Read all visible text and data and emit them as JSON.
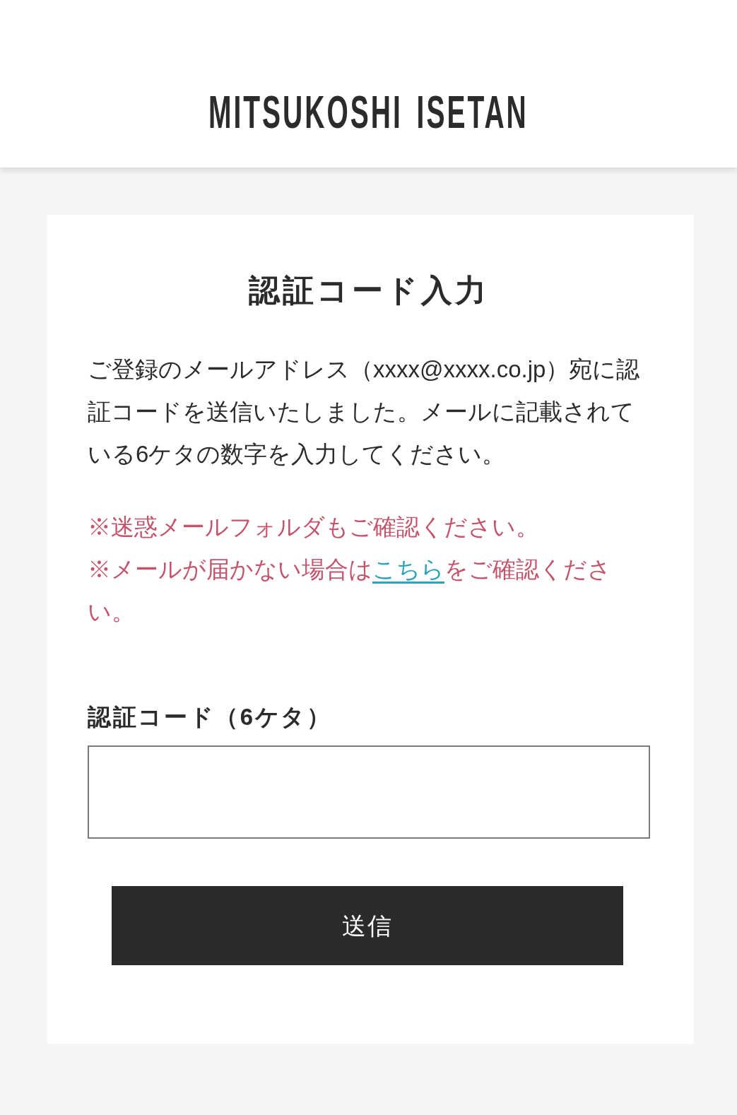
{
  "header": {
    "logo": "MITSUKOSHI ISETAN"
  },
  "card": {
    "title": "認証コード入力",
    "message": "ご登録のメールアドレス（xxxx@xxxx.co.jp）宛に認証コードを送信いたしました。メールに記載されている6ケタの数字を入力してください。",
    "notes": [
      {
        "text": "※迷惑メールフォルダもご確認ください。"
      },
      {
        "text": "※メールが届かない場合は",
        "link": "こちら",
        "after": "をご確認ください。"
      }
    ],
    "field": {
      "label": "認証コード（6ケタ）"
    },
    "button": {
      "label": "送信"
    }
  }
}
